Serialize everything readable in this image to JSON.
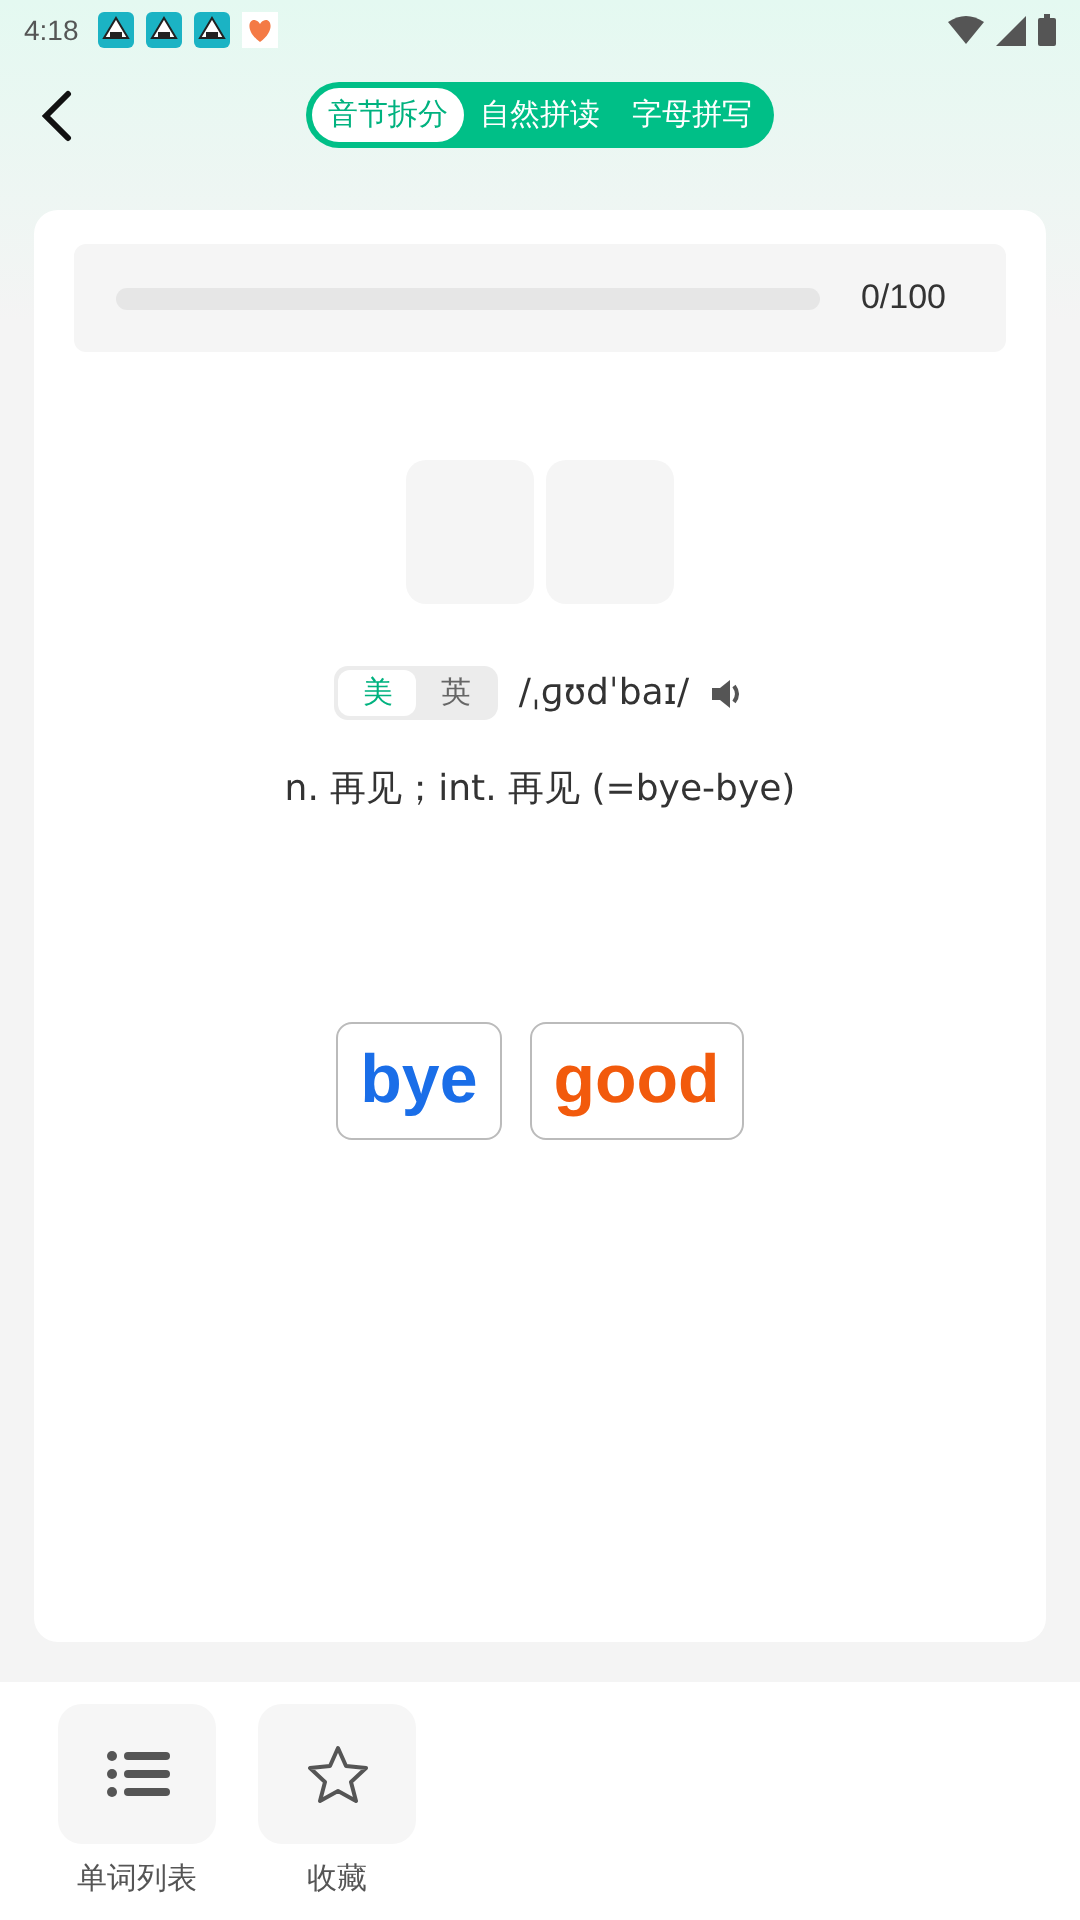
{
  "status_bar": {
    "time": "4:18"
  },
  "tabs": [
    {
      "label": "音节拆分",
      "selected": true
    },
    {
      "label": "自然拼读",
      "selected": false
    },
    {
      "label": "字母拼写",
      "selected": false
    }
  ],
  "progress": {
    "reading": "0/100"
  },
  "slots": [
    {
      "kind": "empty"
    },
    {
      "kind": "empty"
    }
  ],
  "accents": [
    {
      "label": "美",
      "selected": true
    },
    {
      "label": "英",
      "selected": false
    }
  ],
  "phonetic": "/ˌɡʊdˈbaɪ/",
  "definition": "n. 再见；int. 再见 (=bye-bye)",
  "choices": [
    {
      "label": "bye",
      "color": "#1a6ee8"
    },
    {
      "label": "good",
      "color": "#f25a0c"
    }
  ],
  "bottom_buttons": [
    {
      "label": "单词列表",
      "kind": "list"
    },
    {
      "label": "收藏",
      "kind": "star"
    }
  ]
}
